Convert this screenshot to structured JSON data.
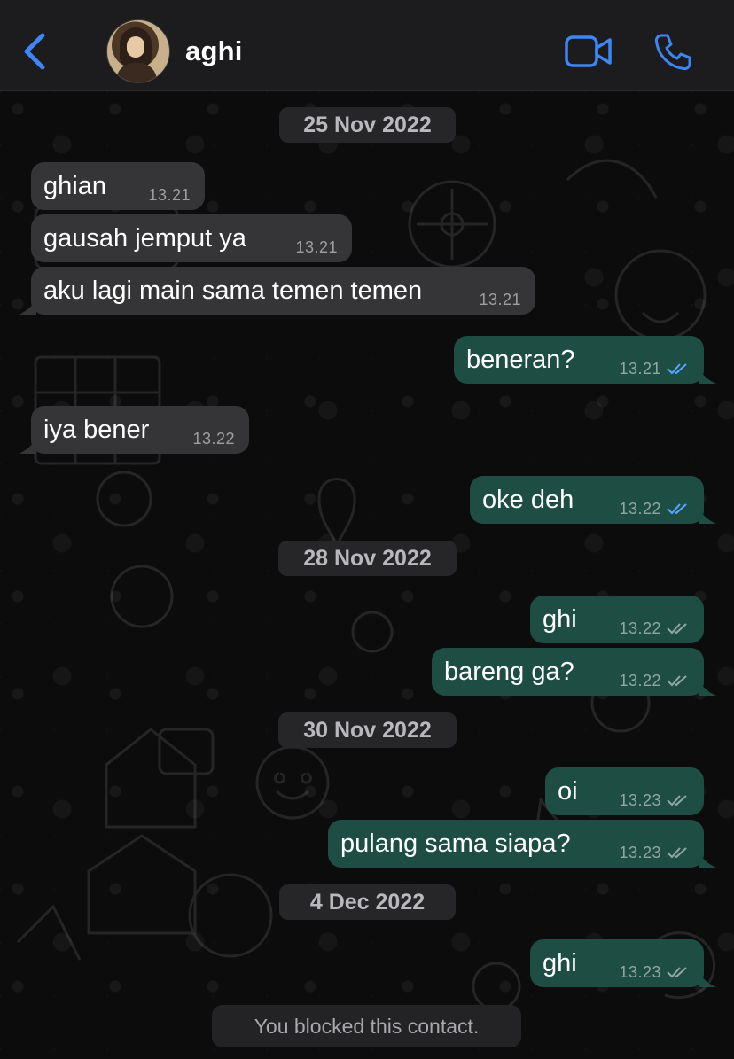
{
  "header": {
    "contact_name": "aghi",
    "back_icon": "chevron-left-icon",
    "video_icon": "video-camera-icon",
    "call_icon": "phone-icon",
    "accent_color": "#3d86f5"
  },
  "date_chips": [
    "25 Nov 2022",
    "28 Nov 2022",
    "30 Nov 2022",
    "4 Dec 2022"
  ],
  "messages": [
    {
      "direction": "in",
      "text": "ghian",
      "time": "13.21"
    },
    {
      "direction": "in",
      "text": "gausah jemput ya",
      "time": "13.21"
    },
    {
      "direction": "in",
      "text": "aku lagi main sama temen temen",
      "time": "13.21"
    },
    {
      "direction": "out",
      "text": "beneran?",
      "time": "13.21",
      "status": "read"
    },
    {
      "direction": "in",
      "text": "iya bener",
      "time": "13.22"
    },
    {
      "direction": "out",
      "text": "oke deh",
      "time": "13.22",
      "status": "read"
    },
    {
      "direction": "out",
      "text": "ghi",
      "time": "13.22",
      "status": "delivered"
    },
    {
      "direction": "out",
      "text": "bareng ga?",
      "time": "13.22",
      "status": "delivered"
    },
    {
      "direction": "out",
      "text": "oi",
      "time": "13.23",
      "status": "delivered"
    },
    {
      "direction": "out",
      "text": "pulang sama siapa?",
      "time": "13.23",
      "status": "delivered"
    },
    {
      "direction": "out",
      "text": "ghi",
      "time": "13.23",
      "status": "delivered"
    }
  ],
  "footer": {
    "blocked_notice": "You blocked this contact."
  },
  "colors": {
    "incoming_bubble": "#353537",
    "outgoing_bubble": "#1d4d43",
    "read_ticks": "#53a6ff",
    "delivered_ticks": "#8fa8a2"
  }
}
